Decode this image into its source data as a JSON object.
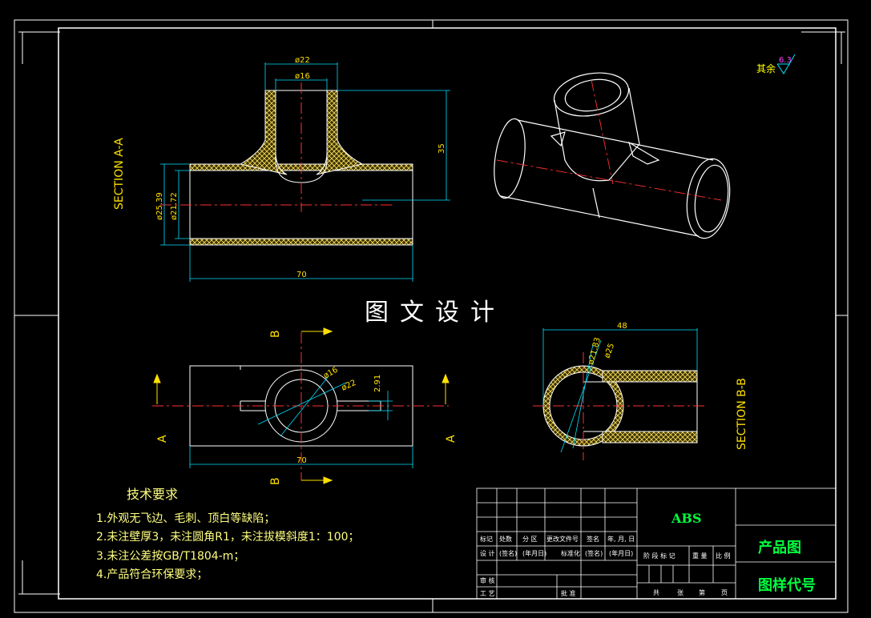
{
  "watermark": "图文设计",
  "section_labels": {
    "aa": "SECTION A-A",
    "bb": "SECTION B-B"
  },
  "view_markers": {
    "a": "A",
    "b": "B"
  },
  "dimensions": {
    "d22_top": "ø22",
    "d16_top": "ø16",
    "h35": "35",
    "d25": "ø25.39",
    "d21": "ø21.72",
    "len70_front": "70",
    "d16_plan": "ø16",
    "d22_plan": "ø22",
    "w291": "2.91",
    "len70_plan": "70",
    "w48": "48",
    "d2183": "ø21.83",
    "d25_side": "ø25"
  },
  "finish": {
    "label": "其余",
    "value": "6.3"
  },
  "tech_requirements": {
    "title": "技术要求",
    "items": [
      "1.外观无飞边、毛刺、顶白等缺陷；",
      "2.未注壁厚3，未注圆角R1，未注拔模斜度1：100；",
      "3.未注公差按GB/T1804-m；",
      "4.产品符合环保要求；"
    ]
  },
  "title_block": {
    "material": "ABS",
    "name": "产品图",
    "code": "图样代号",
    "row_marks": [
      "标记",
      "处数",
      "分 区",
      "更改文件号",
      "签名",
      "年, 月, 日"
    ],
    "row_design": [
      "设 计",
      "(签名)",
      "(年月日)",
      "标准化",
      "(签名)",
      "(年月日)"
    ],
    "stage_labels": [
      "阶 段 标 记",
      "重 量",
      "比 例"
    ],
    "review": "审 核",
    "process": "工 艺",
    "approve": "批 准",
    "sheet": [
      "共",
      "张",
      "第",
      "页"
    ]
  }
}
